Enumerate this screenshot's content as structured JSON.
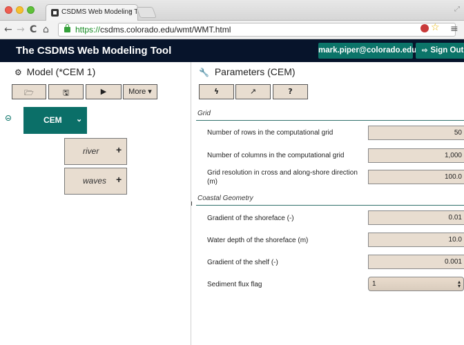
{
  "browser": {
    "tab_title": "CSDMS Web Modeling Tool",
    "tab_close": "×",
    "url_scheme": "https://",
    "url_rest": "csdms.colorado.edu/wmt/WMT.html",
    "nav": {
      "back": "←",
      "forward": "→",
      "reload": "C",
      "home": "⌂"
    },
    "menu_glyph": "≡",
    "star_glyph": "☆",
    "resize_glyph": "⤢"
  },
  "header": {
    "title": "The CSDMS Web Modeling Tool",
    "user": "mark.piper@colorado.edu",
    "signout_icon": "⇨",
    "signout": "Sign Out"
  },
  "model_panel": {
    "heading_icon": "⚙",
    "heading": "Model (*CEM 1)",
    "toolbar": {
      "open_icon": "🗁",
      "save_icon": "🖫",
      "run_icon": "▶",
      "more_label": "More ▾"
    },
    "tree": {
      "root": {
        "label": "CEM",
        "chevron": "⌄"
      },
      "children": [
        {
          "label": "river",
          "add": "+"
        },
        {
          "label": "waves",
          "add": "+"
        }
      ]
    }
  },
  "params_panel": {
    "heading_icon": "🔧",
    "heading": "Parameters (CEM)",
    "toolbar": {
      "bolt_icon": "ϟ",
      "external_icon": "↗",
      "help_label": "?"
    },
    "sections": [
      {
        "title": "Grid",
        "rows": [
          {
            "label": "Number of rows in the computational grid",
            "value": "50"
          },
          {
            "label": "Number of columns in the computational grid",
            "value": "1,000"
          },
          {
            "label": "Grid resolution in cross and along-shore direction (m)",
            "value": "100.0"
          }
        ]
      },
      {
        "title": "Coastal Geometry",
        "rows": [
          {
            "label": "Gradient of the shoreface (-)",
            "value": "0.01"
          },
          {
            "label": "Water depth of the shoreface (m)",
            "value": "10.0"
          },
          {
            "label": "Gradient of the shelf (-)",
            "value": "0.001"
          },
          {
            "label": "Sediment flux flag",
            "value": "1",
            "type": "select"
          }
        ]
      }
    ]
  },
  "colors": {
    "header_bg": "#07142b",
    "accent_teal": "#0b6f68",
    "button_tan": "#e8ddd0"
  }
}
